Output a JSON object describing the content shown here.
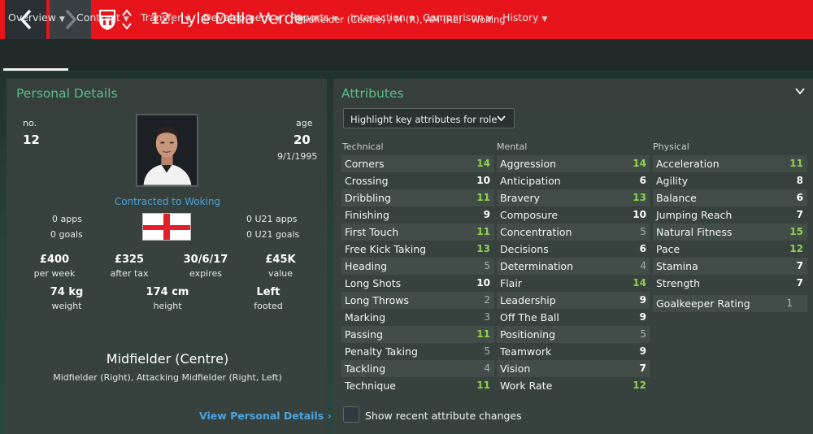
{
  "header": {
    "back_icon": "chevron-left-icon",
    "forward_icon": "chevron-right-icon",
    "club_badge_icon": "woking-crest-icon",
    "player_name": "12. Lyle Della Verde",
    "player_subtitle": "Midfielder (Centre) / M (R), AM (RL) - Woking",
    "accent_color": "#e8141b"
  },
  "tabs": [
    {
      "label": "Overview",
      "active": true
    },
    {
      "label": "Contract"
    },
    {
      "label": "Transfer"
    },
    {
      "label": "Development"
    },
    {
      "label": "Reports"
    },
    {
      "label": "Interaction"
    },
    {
      "label": "Comparison"
    },
    {
      "label": "History"
    }
  ],
  "personal": {
    "title": "Personal Details",
    "no_label": "no.",
    "no_value": "12",
    "age_label": "age",
    "age_value": "20",
    "dob": "9/1/1995",
    "contract_text": "Contracted to Woking",
    "apps": "0 apps",
    "goals": "0 goals",
    "u21_apps": "0 U21 apps",
    "u21_goals": "0 U21 goals",
    "nation_flag": "england-flag-icon",
    "wage_value": "£400",
    "wage_label": "per week",
    "after_tax_value": "£325",
    "after_tax_label": "after tax",
    "expires_value": "30/6/17",
    "expires_label": "expires",
    "value_value": "£45K",
    "value_label": "value",
    "weight_value": "74 kg",
    "weight_label": "weight",
    "height_value": "174 cm",
    "height_label": "height",
    "foot_value": "Left",
    "foot_label": "footed",
    "position_main": "Midfielder (Centre)",
    "position_sub": "Midfielder (Right), Attacking Midfielder (Right, Left)",
    "view_link": "View Personal Details"
  },
  "attributes": {
    "title": "Attributes",
    "dropdown_label": "Highlight key attributes for role",
    "checkbox_label": "Show recent attribute changes",
    "colors": {
      "green": "#8fd14f",
      "white": "#ffffff",
      "grey": "#a9b1af"
    },
    "columns": [
      {
        "heading": "Technical",
        "items": [
          {
            "name": "Corners",
            "value": "14",
            "color": "green"
          },
          {
            "name": "Crossing",
            "value": "10",
            "color": "white"
          },
          {
            "name": "Dribbling",
            "value": "11",
            "color": "green"
          },
          {
            "name": "Finishing",
            "value": "9",
            "color": "white"
          },
          {
            "name": "First Touch",
            "value": "11",
            "color": "green"
          },
          {
            "name": "Free Kick Taking",
            "value": "13",
            "color": "green"
          },
          {
            "name": "Heading",
            "value": "5",
            "color": "grey"
          },
          {
            "name": "Long Shots",
            "value": "10",
            "color": "white"
          },
          {
            "name": "Long Throws",
            "value": "2",
            "color": "grey"
          },
          {
            "name": "Marking",
            "value": "3",
            "color": "grey"
          },
          {
            "name": "Passing",
            "value": "11",
            "color": "green"
          },
          {
            "name": "Penalty Taking",
            "value": "5",
            "color": "grey"
          },
          {
            "name": "Tackling",
            "value": "4",
            "color": "grey"
          },
          {
            "name": "Technique",
            "value": "11",
            "color": "green"
          }
        ]
      },
      {
        "heading": "Mental",
        "items": [
          {
            "name": "Aggression",
            "value": "14",
            "color": "green"
          },
          {
            "name": "Anticipation",
            "value": "6",
            "color": "white"
          },
          {
            "name": "Bravery",
            "value": "13",
            "color": "green"
          },
          {
            "name": "Composure",
            "value": "10",
            "color": "white"
          },
          {
            "name": "Concentration",
            "value": "5",
            "color": "grey"
          },
          {
            "name": "Decisions",
            "value": "6",
            "color": "white"
          },
          {
            "name": "Determination",
            "value": "4",
            "color": "grey"
          },
          {
            "name": "Flair",
            "value": "14",
            "color": "green"
          },
          {
            "name": "Leadership",
            "value": "9",
            "color": "white"
          },
          {
            "name": "Off The Ball",
            "value": "9",
            "color": "white"
          },
          {
            "name": "Positioning",
            "value": "5",
            "color": "grey"
          },
          {
            "name": "Teamwork",
            "value": "9",
            "color": "white"
          },
          {
            "name": "Vision",
            "value": "7",
            "color": "white"
          },
          {
            "name": "Work Rate",
            "value": "12",
            "color": "green"
          }
        ]
      },
      {
        "heading": "Physical",
        "items": [
          {
            "name": "Acceleration",
            "value": "11",
            "color": "green"
          },
          {
            "name": "Agility",
            "value": "8",
            "color": "white"
          },
          {
            "name": "Balance",
            "value": "6",
            "color": "white"
          },
          {
            "name": "Jumping Reach",
            "value": "7",
            "color": "white"
          },
          {
            "name": "Natural Fitness",
            "value": "15",
            "color": "green"
          },
          {
            "name": "Pace",
            "value": "12",
            "color": "green"
          },
          {
            "name": "Stamina",
            "value": "7",
            "color": "white"
          },
          {
            "name": "Strength",
            "value": "7",
            "color": "white"
          },
          {
            "name": "Goalkeeper Rating",
            "value": "1",
            "color": "grey"
          }
        ]
      }
    ]
  }
}
